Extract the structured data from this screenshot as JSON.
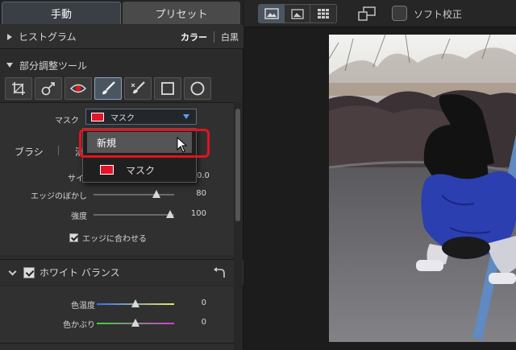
{
  "tabs": {
    "manual": "手動",
    "preset": "プリセット"
  },
  "histogram": {
    "title": "ヒストグラム",
    "color": "カラー",
    "mono": "白黒"
  },
  "local_adjust": {
    "title": "部分調整ツール",
    "tools": [
      "crop-icon",
      "spot-heal-icon",
      "red-eye-icon",
      "brush-icon",
      "erase-brush-icon",
      "rect-mask-icon",
      "circle-mask-icon"
    ],
    "mask_label": "マスク",
    "mask_value": "マスク",
    "mask_color": "#e5132a",
    "brush_tab": "ブラシ",
    "erase_tab_partial": "消",
    "size_label_partial": "サイ",
    "size_value_partial": "0.0",
    "feather": {
      "label": "エッジのぼかし",
      "value": "80",
      "fraction": 0.78
    },
    "strength": {
      "label": "強度",
      "value": "100",
      "fraction": 0.95
    },
    "edge_snap": "エッジに合わせる"
  },
  "dropdown": {
    "new": "新規",
    "mask": "マスク"
  },
  "white_balance": {
    "title": "ホワイト バランス",
    "temperature": {
      "label": "色温度",
      "value": "0",
      "fraction": 0.5
    },
    "tint": {
      "label": "色かぶり",
      "value": "0",
      "fraction": 0.5
    }
  },
  "viewer": {
    "soft_proof": "ソフト校正"
  }
}
